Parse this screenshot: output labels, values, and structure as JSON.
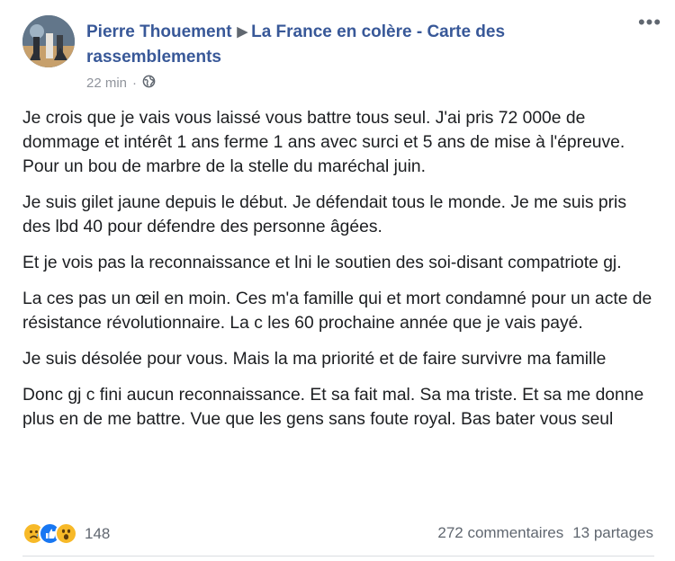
{
  "post": {
    "author": "Pierre Thouement",
    "group": "La France en colère - Carte des rassemblements",
    "time": "22 min",
    "time_separator": "·",
    "privacy_icon": "globe-icon",
    "more_label": "•••",
    "paragraphs": [
      "Je crois que je vais vous laissé vous battre tous seul. J'ai pris 72 000e de dommage et intérêt 1 ans ferme 1 ans avec surci et 5 ans de mise à l'épreuve. Pour un bou de marbre de la stelle du maréchal juin.",
      "Je suis gilet jaune depuis le début. Je défendait tous le monde. Je me suis pris des lbd 40 pour défendre des personne âgées.",
      "Et je vois pas la reconnaissance et lni le soutien des soi-disant compatriote gj.",
      "La ces pas un œil en moin. Ces m'a famille qui et mort condamné pour un acte de résistance révolutionnaire. La c les 60 prochaine année que je vais payé.",
      "Je suis désolée pour vous. Mais la ma priorité et de faire survivre ma famille",
      "Donc gj c fini aucun reconnaissance. Et sa fait mal. Sa ma triste. Et sa me donne plus en de me battre. Vue que les gens sans foute royal. Bas bater vous seul"
    ]
  },
  "footer": {
    "reactions": [
      "sad-reaction-icon",
      "like-reaction-icon",
      "wow-reaction-icon"
    ],
    "reaction_count": "148",
    "comments": "272 commentaires",
    "shares": "13 partages"
  },
  "colors": {
    "link": "#385898",
    "text": "#1c1e21",
    "meta": "#90949c",
    "like": "#1877f2",
    "emoji": "#f7b928"
  }
}
